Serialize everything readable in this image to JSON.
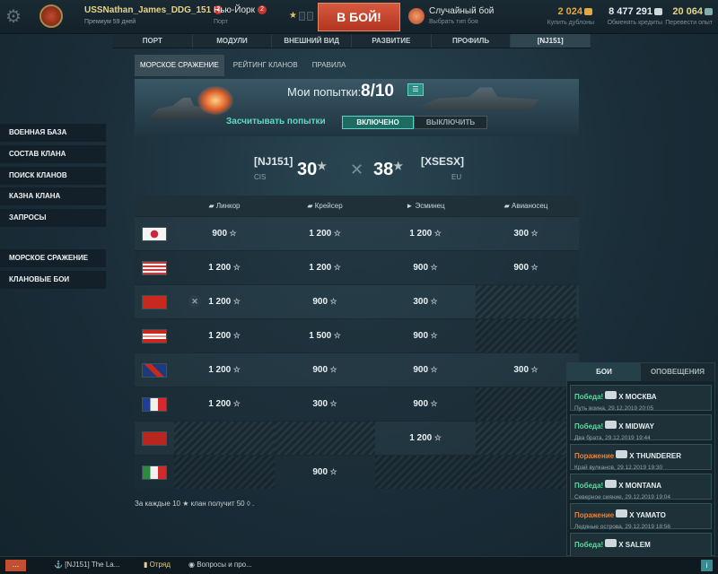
{
  "topbar": {
    "username": "USSNathan_James_DDG_151",
    "username_badge": "2",
    "premium": "Премиум 59 дней",
    "port": "Нью-Йорк",
    "port_badge": "2",
    "port_sub": "Порт",
    "battle_button": "В БОЙ!",
    "mode": "Случайный бой",
    "mode_sub": "Выбрать тип боя",
    "doubloons": "2 024",
    "doubloons_sub": "Купить дублоны",
    "credits": "8 477 291",
    "credits_sub": "Обменять кредиты",
    "free_xp": "20 064",
    "free_xp_sub": "Перевести опыт",
    "colors": {
      "doubloons": "#e8a93a",
      "credits": "#cfd8dc",
      "free_xp": "#e6d48a"
    }
  },
  "nav": {
    "items": [
      {
        "label": "ПОРТ"
      },
      {
        "label": "МОДУЛИ"
      },
      {
        "label": "ВНЕШНИЙ ВИД"
      },
      {
        "label": "РАЗВИТИЕ"
      },
      {
        "label": "ПРОФИЛЬ"
      },
      {
        "label": "[NJ151]"
      }
    ]
  },
  "subtabs": [
    "МОРСКОЕ СРАЖЕНИЕ",
    "РЕЙТИНГ КЛАНОВ",
    "ПРАВИЛА"
  ],
  "banner": {
    "attempts_label": "Мои попытки:",
    "attempts_value": "8/10",
    "count_label": "Засчитывать попытки",
    "toggle_on": "ВКЛЮЧЕНО",
    "toggle_off": "ВЫКЛЮЧИТЬ"
  },
  "score": {
    "left_tag": "[NJ151]",
    "left_region": "CIS",
    "left_score": "30",
    "right_score": "38",
    "right_tag": "[XSESX]",
    "right_region": "EU"
  },
  "table": {
    "headers": [
      "Линкор",
      "Крейсер",
      "Эсминец",
      "Авианосец"
    ],
    "rows": [
      {
        "nation": "Japan",
        "cells": [
          "900",
          "1 200",
          "1 200",
          "300"
        ]
      },
      {
        "nation": "USA",
        "cells": [
          "1 200",
          "1 200",
          "900",
          "900"
        ]
      },
      {
        "nation": "USSR",
        "cells": [
          "1 200",
          "900",
          "300",
          ""
        ]
      },
      {
        "nation": "Germany",
        "cells": [
          "1 200",
          "1 500",
          "900",
          ""
        ]
      },
      {
        "nation": "UK",
        "cells": [
          "1 200",
          "900",
          "900",
          "300"
        ]
      },
      {
        "nation": "France",
        "cells": [
          "1 200",
          "300",
          "900",
          ""
        ]
      },
      {
        "nation": "Pan-Asia",
        "cells": [
          "",
          "",
          "1 200",
          ""
        ]
      },
      {
        "nation": "Italy",
        "cells": [
          "",
          "900",
          "",
          ""
        ]
      }
    ],
    "footer": "За каждые 10 ★ клан получит 50 ◊ ."
  },
  "sidebar": {
    "group1": [
      "ВОЕННАЯ БАЗА",
      "СОСТАВ КЛАНА",
      "ПОИСК КЛАНОВ",
      "КАЗНА КЛАНА",
      "ЗАПРОСЫ"
    ],
    "group2": [
      "МОРСКОЕ СРАЖЕНИЕ",
      "КЛАНОВЫЕ БОИ"
    ]
  },
  "notifications": {
    "tabs": [
      "БОИ",
      "ОПОВЕЩЕНИЯ"
    ],
    "items": [
      {
        "result": "Победа!",
        "ship": "X МОСКВА",
        "sub": "Путь воина, 29.12.2019 20:05",
        "win": true
      },
      {
        "result": "Победа!",
        "ship": "X MIDWAY",
        "sub": "Два брата, 29.12.2019 19:44",
        "win": true
      },
      {
        "result": "Поражение",
        "ship": "X THUNDERER",
        "sub": "Край вулканов, 29.12.2019 19:30",
        "win": false
      },
      {
        "result": "Победа!",
        "ship": "X MONTANA",
        "sub": "Северное сияние, 29.12.2019 19:04",
        "win": true
      },
      {
        "result": "Поражение",
        "ship": "X YAMATO",
        "sub": "Ледяные острова, 29.12.2019 18:56",
        "win": false
      },
      {
        "result": "Победа!",
        "ship": "X SALEM",
        "sub": "",
        "win": true
      }
    ]
  },
  "bottombar": {
    "menu": "...",
    "clan": "[NJ151] The La...",
    "division": "Отряд",
    "help": "Вопросы и про...",
    "info": "i"
  }
}
